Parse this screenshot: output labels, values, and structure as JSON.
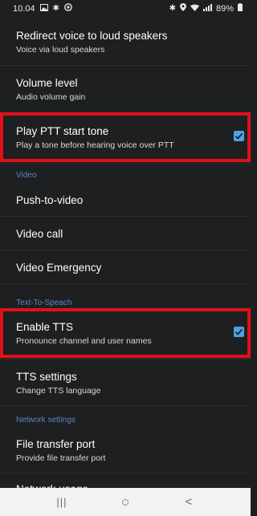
{
  "status_bar": {
    "time": "10.04",
    "battery": "89%",
    "left_icons": [
      "gallery-icon",
      "bluetooth-icon",
      "app-icon"
    ],
    "right_icons": [
      "bluetooth-icon",
      "location-icon",
      "wifi-icon",
      "signal-icon",
      "battery-icon"
    ]
  },
  "settings": {
    "redirect_voice": {
      "title": "Redirect voice to loud speakers",
      "summary": "Voice via loud speakers"
    },
    "volume_level": {
      "title": "Volume level",
      "summary": "Audio volume gain"
    },
    "ptt_start_tone": {
      "title": "Play PTT start tone",
      "summary": "Play a tone before hearing voice over PTT",
      "checked": true
    },
    "section_video": "Video",
    "push_to_video": {
      "title": "Push-to-video"
    },
    "video_call": {
      "title": "Video call"
    },
    "video_emergency": {
      "title": "Video Emergency"
    },
    "section_tts": "Text-To-Speach",
    "enable_tts": {
      "title": "Enable TTS",
      "summary": "Pronounce channel and user names",
      "checked": true
    },
    "tts_settings": {
      "title": "TTS settings",
      "summary": "Change TTS language"
    },
    "section_network": "Network settings",
    "file_transfer_port": {
      "title": "File transfer port",
      "summary": "Provide file transfer port"
    },
    "network_usage_partial": {
      "title": "Network usage"
    }
  },
  "nav_bar": {
    "recents": "|||",
    "home": "○",
    "back": "<"
  },
  "colors": {
    "background": "#1e1f20",
    "accent": "#4aa3e8",
    "section_header": "#5b86c4",
    "highlight": "#e0101a"
  }
}
